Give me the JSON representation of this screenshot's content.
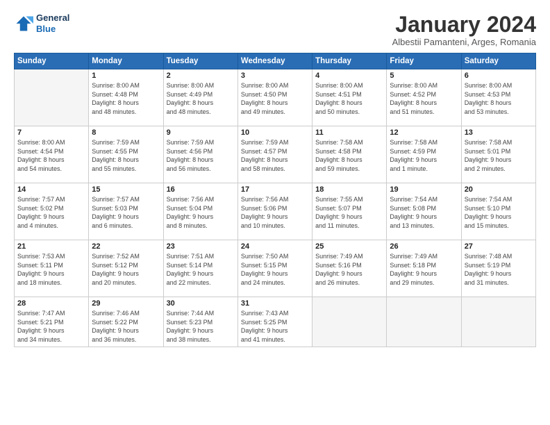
{
  "logo": {
    "line1": "General",
    "line2": "Blue"
  },
  "title": "January 2024",
  "subtitle": "Albestii Pamanteni, Arges, Romania",
  "weekdays": [
    "Sunday",
    "Monday",
    "Tuesday",
    "Wednesday",
    "Thursday",
    "Friday",
    "Saturday"
  ],
  "weeks": [
    [
      {
        "day": "",
        "info": ""
      },
      {
        "day": "1",
        "info": "Sunrise: 8:00 AM\nSunset: 4:48 PM\nDaylight: 8 hours\nand 48 minutes."
      },
      {
        "day": "2",
        "info": "Sunrise: 8:00 AM\nSunset: 4:49 PM\nDaylight: 8 hours\nand 48 minutes."
      },
      {
        "day": "3",
        "info": "Sunrise: 8:00 AM\nSunset: 4:50 PM\nDaylight: 8 hours\nand 49 minutes."
      },
      {
        "day": "4",
        "info": "Sunrise: 8:00 AM\nSunset: 4:51 PM\nDaylight: 8 hours\nand 50 minutes."
      },
      {
        "day": "5",
        "info": "Sunrise: 8:00 AM\nSunset: 4:52 PM\nDaylight: 8 hours\nand 51 minutes."
      },
      {
        "day": "6",
        "info": "Sunrise: 8:00 AM\nSunset: 4:53 PM\nDaylight: 8 hours\nand 53 minutes."
      }
    ],
    [
      {
        "day": "7",
        "info": "Sunrise: 8:00 AM\nSunset: 4:54 PM\nDaylight: 8 hours\nand 54 minutes."
      },
      {
        "day": "8",
        "info": "Sunrise: 7:59 AM\nSunset: 4:55 PM\nDaylight: 8 hours\nand 55 minutes."
      },
      {
        "day": "9",
        "info": "Sunrise: 7:59 AM\nSunset: 4:56 PM\nDaylight: 8 hours\nand 56 minutes."
      },
      {
        "day": "10",
        "info": "Sunrise: 7:59 AM\nSunset: 4:57 PM\nDaylight: 8 hours\nand 58 minutes."
      },
      {
        "day": "11",
        "info": "Sunrise: 7:58 AM\nSunset: 4:58 PM\nDaylight: 8 hours\nand 59 minutes."
      },
      {
        "day": "12",
        "info": "Sunrise: 7:58 AM\nSunset: 4:59 PM\nDaylight: 9 hours\nand 1 minute."
      },
      {
        "day": "13",
        "info": "Sunrise: 7:58 AM\nSunset: 5:01 PM\nDaylight: 9 hours\nand 2 minutes."
      }
    ],
    [
      {
        "day": "14",
        "info": "Sunrise: 7:57 AM\nSunset: 5:02 PM\nDaylight: 9 hours\nand 4 minutes."
      },
      {
        "day": "15",
        "info": "Sunrise: 7:57 AM\nSunset: 5:03 PM\nDaylight: 9 hours\nand 6 minutes."
      },
      {
        "day": "16",
        "info": "Sunrise: 7:56 AM\nSunset: 5:04 PM\nDaylight: 9 hours\nand 8 minutes."
      },
      {
        "day": "17",
        "info": "Sunrise: 7:56 AM\nSunset: 5:06 PM\nDaylight: 9 hours\nand 10 minutes."
      },
      {
        "day": "18",
        "info": "Sunrise: 7:55 AM\nSunset: 5:07 PM\nDaylight: 9 hours\nand 11 minutes."
      },
      {
        "day": "19",
        "info": "Sunrise: 7:54 AM\nSunset: 5:08 PM\nDaylight: 9 hours\nand 13 minutes."
      },
      {
        "day": "20",
        "info": "Sunrise: 7:54 AM\nSunset: 5:10 PM\nDaylight: 9 hours\nand 15 minutes."
      }
    ],
    [
      {
        "day": "21",
        "info": "Sunrise: 7:53 AM\nSunset: 5:11 PM\nDaylight: 9 hours\nand 18 minutes."
      },
      {
        "day": "22",
        "info": "Sunrise: 7:52 AM\nSunset: 5:12 PM\nDaylight: 9 hours\nand 20 minutes."
      },
      {
        "day": "23",
        "info": "Sunrise: 7:51 AM\nSunset: 5:14 PM\nDaylight: 9 hours\nand 22 minutes."
      },
      {
        "day": "24",
        "info": "Sunrise: 7:50 AM\nSunset: 5:15 PM\nDaylight: 9 hours\nand 24 minutes."
      },
      {
        "day": "25",
        "info": "Sunrise: 7:49 AM\nSunset: 5:16 PM\nDaylight: 9 hours\nand 26 minutes."
      },
      {
        "day": "26",
        "info": "Sunrise: 7:49 AM\nSunset: 5:18 PM\nDaylight: 9 hours\nand 29 minutes."
      },
      {
        "day": "27",
        "info": "Sunrise: 7:48 AM\nSunset: 5:19 PM\nDaylight: 9 hours\nand 31 minutes."
      }
    ],
    [
      {
        "day": "28",
        "info": "Sunrise: 7:47 AM\nSunset: 5:21 PM\nDaylight: 9 hours\nand 34 minutes."
      },
      {
        "day": "29",
        "info": "Sunrise: 7:46 AM\nSunset: 5:22 PM\nDaylight: 9 hours\nand 36 minutes."
      },
      {
        "day": "30",
        "info": "Sunrise: 7:44 AM\nSunset: 5:23 PM\nDaylight: 9 hours\nand 38 minutes."
      },
      {
        "day": "31",
        "info": "Sunrise: 7:43 AM\nSunset: 5:25 PM\nDaylight: 9 hours\nand 41 minutes."
      },
      {
        "day": "",
        "info": ""
      },
      {
        "day": "",
        "info": ""
      },
      {
        "day": "",
        "info": ""
      }
    ]
  ]
}
